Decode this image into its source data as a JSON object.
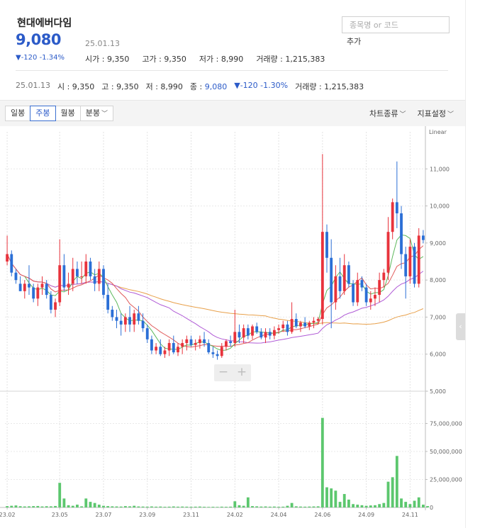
{
  "stock": {
    "name": "현대에버다임",
    "price": "9,080",
    "date": "25.01.13",
    "change": "▼-120 -1.34%",
    "open": "시가 : 9,350",
    "high": "고가 : 9,350",
    "low": "저가 : 8,990",
    "volume": "거래량 : 1,215,383"
  },
  "search": {
    "placeholder": "종목명 or 코드",
    "add_label": "추가"
  },
  "quote_line": {
    "date": "25.01.13",
    "open": "시 : 9,350",
    "high": "고 : 9,350",
    "low": "저 : 8,990",
    "close_label": "종 :",
    "close_value": "9,080",
    "change": "▼-120 -1.30%",
    "volume": "거래량 : 1,215,383"
  },
  "toolbar": {
    "tabs": [
      "일봉",
      "주봉",
      "월봉",
      "분봉"
    ],
    "active_tab": "주봉",
    "chart_type": "차트종류",
    "indicator": "지표설정",
    "zoom_out": "−",
    "zoom_in": "+"
  },
  "colors": {
    "up": "#e8333c",
    "down": "#2b6fd6",
    "accent": "#2c5bc8",
    "ma5": "#5cb85c",
    "ma20": "#e05a5a",
    "ma60": "#b05bd6",
    "ma120": "#e8a04a",
    "volume": "#5cc76e"
  },
  "chart_data": {
    "type": "candlestick",
    "scale_label": "Linear",
    "y_ticks": [
      "11,000",
      "10,000",
      "9,000",
      "8,000",
      "7,000",
      "6,000",
      "5,000"
    ],
    "y_tick_values": [
      11000,
      10000,
      9000,
      8000,
      7000,
      6000,
      5000
    ],
    "y_range": [
      5000,
      12000
    ],
    "volume_ticks": [
      "75,000,000",
      "50,000,000",
      "25,000,000",
      "0"
    ],
    "volume_tick_values": [
      75000000,
      50000000,
      25000000,
      0
    ],
    "volume_range": [
      0,
      100000000
    ],
    "x_labels": [
      "23.02",
      "23.05",
      "23.07",
      "23.09",
      "23.11",
      "24.02",
      "24.04",
      "24.06",
      "24.09",
      "24.11"
    ],
    "x_label_index": [
      0,
      12,
      22,
      32,
      42,
      52,
      62,
      72,
      82,
      92
    ],
    "candles": [
      [
        8500,
        9200,
        8400,
        8700
      ],
      [
        8700,
        8800,
        8100,
        8200
      ],
      [
        8200,
        8300,
        7900,
        8000
      ],
      [
        7900,
        8100,
        7700,
        7700
      ],
      [
        7700,
        8000,
        7500,
        7900
      ],
      [
        7900,
        8400,
        7600,
        7800
      ],
      [
        7800,
        7900,
        7400,
        7500
      ],
      [
        7500,
        7900,
        7300,
        7800
      ],
      [
        7800,
        8100,
        7600,
        7900
      ],
      [
        7900,
        8000,
        7500,
        7600
      ],
      [
        7600,
        7700,
        7100,
        7200
      ],
      [
        7200,
        7500,
        7000,
        7400
      ],
      [
        7400,
        9100,
        7300,
        8400
      ],
      [
        8400,
        8700,
        7700,
        7800
      ],
      [
        7800,
        8200,
        7600,
        7900
      ],
      [
        7900,
        8600,
        7700,
        8300
      ],
      [
        8300,
        8500,
        7900,
        8100
      ],
      [
        8100,
        8500,
        7900,
        8100
      ],
      [
        8100,
        8700,
        7900,
        8500
      ],
      [
        8500,
        8600,
        8000,
        8100
      ],
      [
        8100,
        8300,
        7700,
        7900
      ],
      [
        7900,
        8500,
        7700,
        8300
      ],
      [
        8300,
        8400,
        7500,
        7600
      ],
      [
        7600,
        7900,
        7100,
        7200
      ],
      [
        7200,
        7300,
        6900,
        7000
      ],
      [
        7000,
        7200,
        6700,
        6900
      ],
      [
        6900,
        7100,
        6500,
        6800
      ],
      [
        6800,
        7100,
        6600,
        7000
      ],
      [
        7000,
        7300,
        6600,
        6800
      ],
      [
        6800,
        7200,
        6600,
        7100
      ],
      [
        7100,
        7300,
        6800,
        6900
      ],
      [
        6900,
        7100,
        6600,
        6700
      ],
      [
        6700,
        6800,
        6300,
        6400
      ],
      [
        6400,
        6500,
        6000,
        6100
      ],
      [
        6100,
        6300,
        6000,
        6200
      ],
      [
        6200,
        6400,
        5950,
        6000
      ],
      [
        6000,
        6200,
        5900,
        6100
      ],
      [
        6100,
        6400,
        5950,
        6300
      ],
      [
        6300,
        6500,
        6000,
        6050
      ],
      [
        6050,
        6300,
        5950,
        6200
      ],
      [
        6200,
        6400,
        6000,
        6300
      ],
      [
        6300,
        6500,
        6100,
        6400
      ],
      [
        6400,
        6500,
        6200,
        6250
      ],
      [
        6250,
        6400,
        6100,
        6300
      ],
      [
        6300,
        6500,
        6150,
        6400
      ],
      [
        6400,
        6600,
        6200,
        6300
      ],
      [
        6300,
        6400,
        6000,
        6050
      ],
      [
        6050,
        6200,
        5900,
        6000
      ],
      [
        6000,
        6100,
        5850,
        5950
      ],
      [
        5950,
        6300,
        5900,
        6200
      ],
      [
        6200,
        6400,
        6100,
        6350
      ],
      [
        6350,
        6500,
        6200,
        6300
      ],
      [
        6300,
        7200,
        6200,
        6600
      ],
      [
        6600,
        6800,
        6300,
        6450
      ],
      [
        6450,
        6800,
        6300,
        6700
      ],
      [
        6700,
        6800,
        6400,
        6500
      ],
      [
        6500,
        6800,
        6400,
        6750
      ],
      [
        6750,
        6850,
        6550,
        6600
      ],
      [
        6600,
        6700,
        6400,
        6450
      ],
      [
        6450,
        6700,
        6300,
        6600
      ],
      [
        6600,
        6700,
        6400,
        6500
      ],
      [
        6500,
        6750,
        6400,
        6650
      ],
      [
        6650,
        6800,
        6550,
        6700
      ],
      [
        6700,
        6900,
        6600,
        6800
      ],
      [
        6800,
        6900,
        6500,
        6600
      ],
      [
        6600,
        7400,
        6550,
        6950
      ],
      [
        6950,
        7100,
        6700,
        6750
      ],
      [
        6750,
        6900,
        6600,
        6850
      ],
      [
        6850,
        7000,
        6700,
        6750
      ],
      [
        6750,
        6900,
        6650,
        6850
      ],
      [
        6850,
        7000,
        6700,
        6900
      ],
      [
        6900,
        7000,
        6800,
        6950
      ],
      [
        6950,
        11400,
        6800,
        9300
      ],
      [
        9300,
        9500,
        8200,
        8600
      ],
      [
        8600,
        9100,
        6700,
        7400
      ],
      [
        7400,
        8400,
        7200,
        8100
      ],
      [
        8100,
        8600,
        7500,
        7700
      ],
      [
        7700,
        8700,
        7600,
        8400
      ],
      [
        8400,
        8500,
        7800,
        7900
      ],
      [
        7900,
        8000,
        7300,
        7400
      ],
      [
        7400,
        8200,
        7300,
        8000
      ],
      [
        8000,
        8100,
        7700,
        7800
      ],
      [
        7800,
        7900,
        7300,
        7400
      ],
      [
        7400,
        7700,
        7200,
        7500
      ],
      [
        7500,
        7800,
        7300,
        7600
      ],
      [
        7600,
        8200,
        7400,
        8000
      ],
      [
        8000,
        8300,
        7800,
        8200
      ],
      [
        8200,
        9700,
        8000,
        9300
      ],
      [
        9300,
        10200,
        9100,
        10100
      ],
      [
        10100,
        11200,
        9400,
        9800
      ],
      [
        9800,
        10000,
        8300,
        8700
      ],
      [
        8700,
        8900,
        7500,
        8100
      ],
      [
        8100,
        9100,
        7900,
        8900
      ],
      [
        8900,
        9000,
        7800,
        7900
      ],
      [
        7900,
        9400,
        7800,
        9200
      ],
      [
        9200,
        9350,
        8990,
        9080
      ]
    ],
    "volumes": [
      1200000,
      1500000,
      1800000,
      1100000,
      900000,
      1000000,
      1200000,
      1300000,
      900000,
      1100000,
      1000000,
      1300000,
      22000000,
      8000000,
      2000000,
      1500000,
      2500000,
      1000000,
      8000000,
      5000000,
      4000000,
      2500000,
      1500000,
      1200000,
      1000000,
      900000,
      800000,
      1200000,
      1000000,
      1500000,
      900000,
      800000,
      700000,
      900000,
      700000,
      800000,
      600000,
      700000,
      900000,
      700000,
      800000,
      700000,
      600000,
      700000,
      800000,
      600000,
      500000,
      600000,
      500000,
      700000,
      600000,
      700000,
      5500000,
      2000000,
      1500000,
      9000000,
      1200000,
      1000000,
      800000,
      900000,
      700000,
      800000,
      600000,
      700000,
      1500000,
      4000000,
      1000000,
      800000,
      700000,
      800000,
      900000,
      1000000,
      80000000,
      18000000,
      17000000,
      15000000,
      5000000,
      12000000,
      7000000,
      3000000,
      2500000,
      2000000,
      1500000,
      1800000,
      2000000,
      3000000,
      4000000,
      23000000,
      27000000,
      46000000,
      8000000,
      5000000,
      3000000,
      6000000,
      9000000,
      2500000,
      1200000
    ]
  }
}
